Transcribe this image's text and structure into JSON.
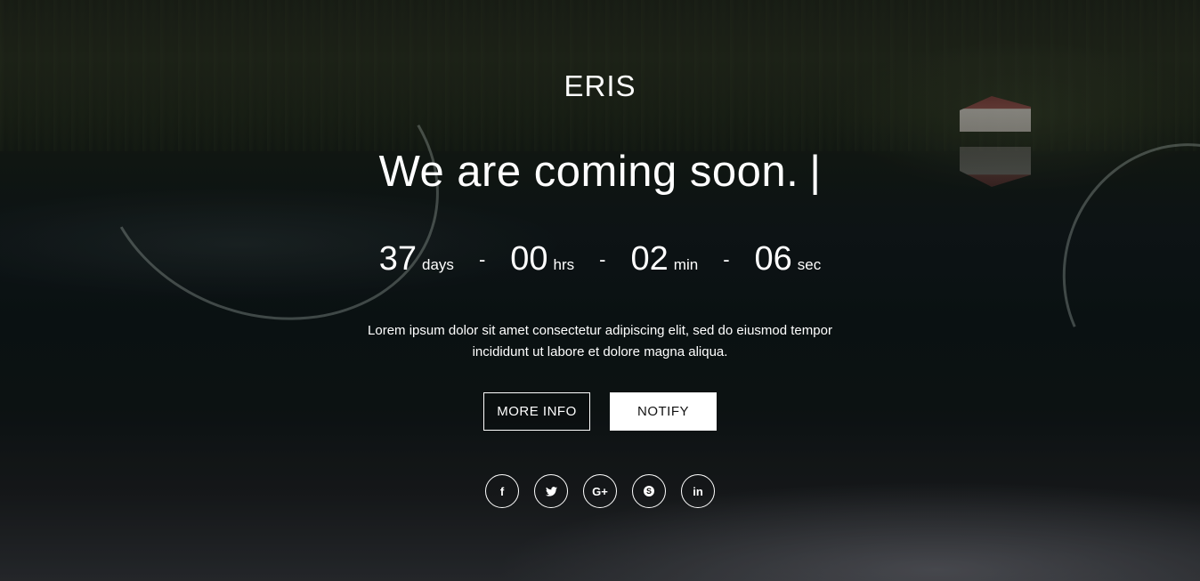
{
  "brand": {
    "name": "ERIS"
  },
  "hero": {
    "headline": "We are coming soon.",
    "cursor": "|"
  },
  "countdown": {
    "units": [
      {
        "value": "37",
        "label": "days"
      },
      {
        "value": "00",
        "label": "hrs"
      },
      {
        "value": "02",
        "label": "min"
      },
      {
        "value": "06",
        "label": "sec"
      }
    ],
    "separator": "-"
  },
  "description": {
    "line1": "Lorem ipsum dolor sit amet consectetur adipiscing elit, sed do eiusmod tempor",
    "line2": "incididunt ut labore et dolore magna aliqua."
  },
  "actions": {
    "more_info_label": "MORE INFO",
    "notify_label": "NOTIFY"
  },
  "social": [
    {
      "icon": "facebook-icon",
      "glyph": "f"
    },
    {
      "icon": "twitter-icon",
      "glyph": "🐦"
    },
    {
      "icon": "google-plus-icon",
      "glyph": "G+"
    },
    {
      "icon": "skype-icon",
      "glyph": "S"
    },
    {
      "icon": "linkedin-icon",
      "glyph": "in"
    }
  ],
  "colors": {
    "text": "#ffffff",
    "button_solid_bg": "#ffffff",
    "button_solid_text": "#111111"
  }
}
